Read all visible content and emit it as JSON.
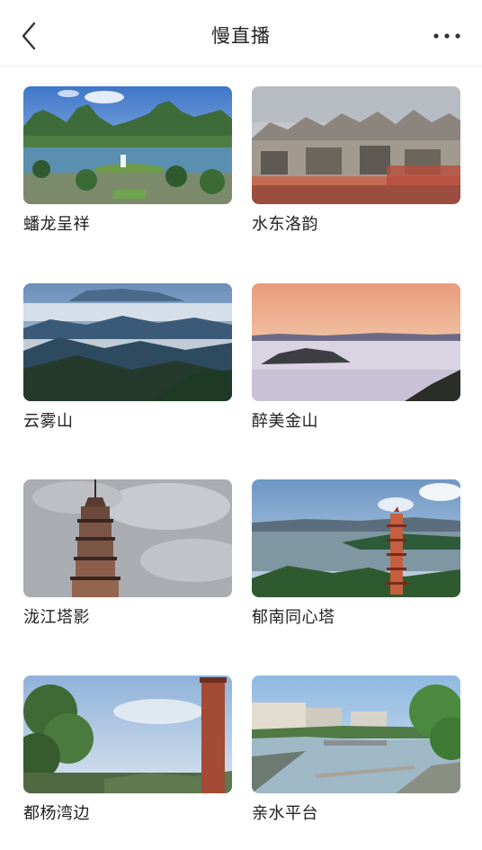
{
  "header": {
    "title": "慢直播",
    "back_icon": "chevron-left-icon",
    "more_icon": "more-horizontal-icon"
  },
  "items": [
    {
      "label": "蟠龙呈祥"
    },
    {
      "label": "水东洛韵"
    },
    {
      "label": "云雾山"
    },
    {
      "label": "醉美金山"
    },
    {
      "label": "泷江塔影"
    },
    {
      "label": "郁南同心塔"
    },
    {
      "label": "都杨湾边"
    },
    {
      "label": "亲水平台"
    }
  ]
}
